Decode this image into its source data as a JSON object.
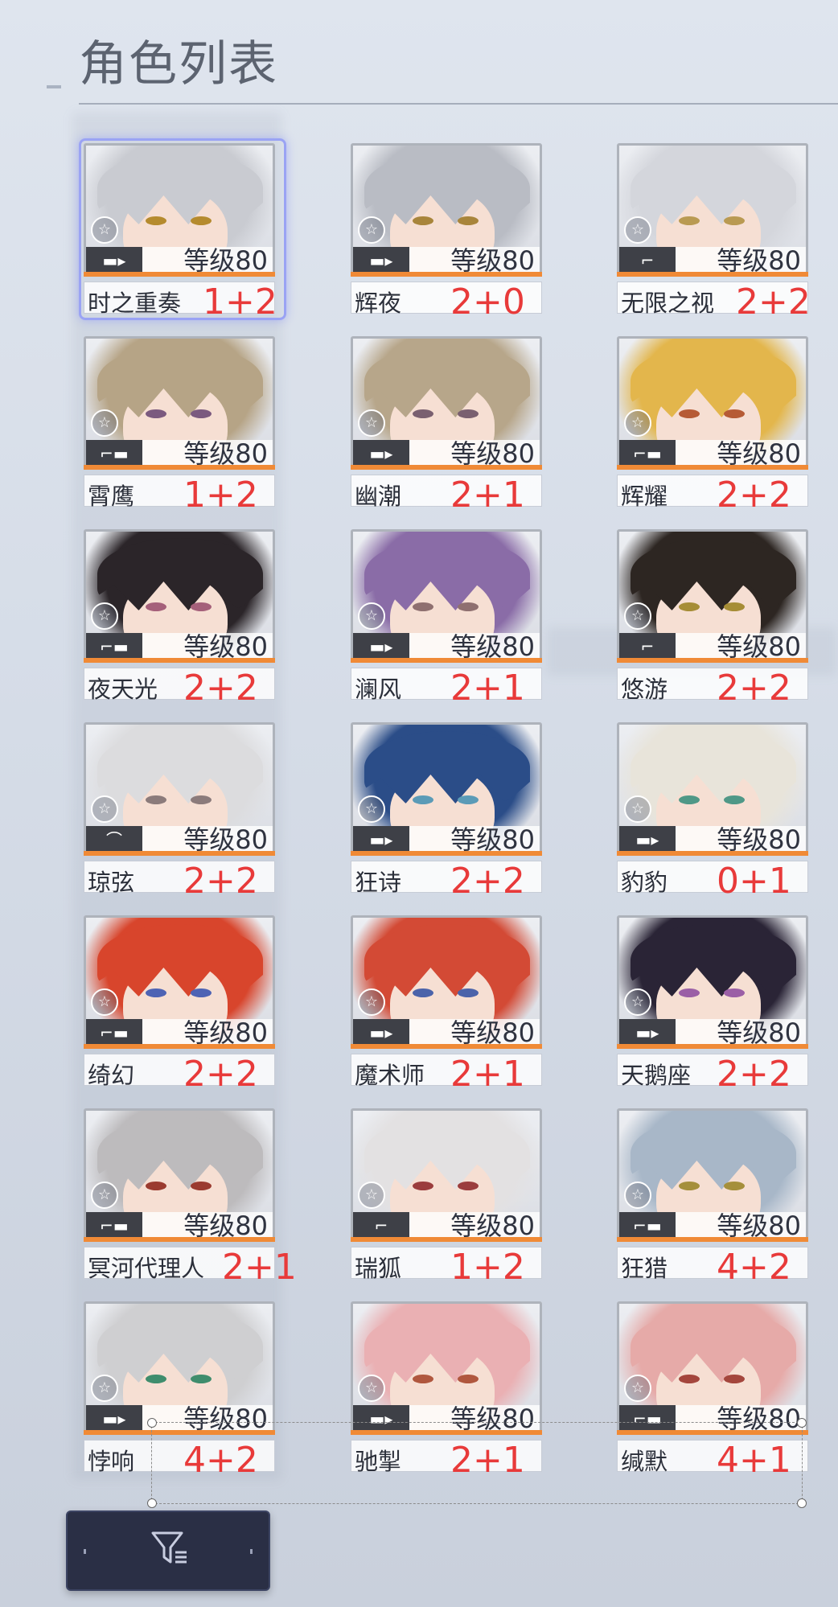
{
  "header": {
    "title": "角色列表"
  },
  "level_prefix": "等级",
  "characters": [
    {
      "name": "时之重奏",
      "level": "80",
      "score": "1+2",
      "hair": "#c9cbd1",
      "eye": "#b58b2e",
      "weapon": "▬▸"
    },
    {
      "name": "辉夜",
      "level": "80",
      "score": "2+0",
      "hair": "#b9bcc4",
      "eye": "#a8853b",
      "weapon": "▬▸"
    },
    {
      "name": "无限之视",
      "level": "80",
      "score": "2+2",
      "hair": "#d4d6dc",
      "eye": "#b99a52",
      "weapon": "⌐"
    },
    {
      "name": "霄鹰",
      "level": "80",
      "score": "1+2",
      "hair": "#b6a486",
      "eye": "#7b5a7f",
      "weapon": "⌐▬"
    },
    {
      "name": "幽潮",
      "level": "80",
      "score": "2+1",
      "hair": "#b7a68a",
      "eye": "#7a6070",
      "weapon": "▬▸"
    },
    {
      "name": "辉耀",
      "level": "80",
      "score": "2+2",
      "hair": "#e3b64c",
      "eye": "#b65b35",
      "weapon": "⌐▬"
    },
    {
      "name": "夜天光",
      "level": "80",
      "score": "2+2",
      "hair": "#2b2529",
      "eye": "#a5607a",
      "weapon": "⌐▬"
    },
    {
      "name": "澜风",
      "level": "80",
      "score": "2+1",
      "hair": "#8a6ca7",
      "eye": "#8f7070",
      "weapon": "▬▸"
    },
    {
      "name": "悠游",
      "level": "80",
      "score": "2+2",
      "hair": "#2d2622",
      "eye": "#a68d36",
      "weapon": "⌐"
    },
    {
      "name": "琼弦",
      "level": "80",
      "score": "2+2",
      "hair": "#dcdcde",
      "eye": "#8b7b7b",
      "weapon": "⌒"
    },
    {
      "name": "狂诗",
      "level": "80",
      "score": "2+2",
      "hair": "#2b4d88",
      "eye": "#5b9bb7",
      "weapon": "▬▸"
    },
    {
      "name": "豹豹",
      "level": "80",
      "score": "0+1",
      "hair": "#e8e4da",
      "eye": "#4f9887",
      "weapon": "▬▸"
    },
    {
      "name": "绮幻",
      "level": "80",
      "score": "2+2",
      "hair": "#d8452c",
      "eye": "#4e63b4",
      "weapon": "⌐▬"
    },
    {
      "name": "魔术师",
      "level": "80",
      "score": "2+1",
      "hair": "#d34a35",
      "eye": "#4b63aa",
      "weapon": "▬▸"
    },
    {
      "name": "天鹅座",
      "level": "80",
      "score": "2+2",
      "hair": "#2a2436",
      "eye": "#9b5fa6",
      "weapon": "▬▸"
    },
    {
      "name": "冥河代理人",
      "level": "80",
      "score": "2+1",
      "hair": "#bdbbbd",
      "eye": "#9b3b30",
      "weapon": "⌐▬"
    },
    {
      "name": "瑞狐",
      "level": "80",
      "score": "1+2",
      "hair": "#e3e1e2",
      "eye": "#9b3d3d",
      "weapon": "⌐"
    },
    {
      "name": "狂猎",
      "level": "80",
      "score": "4+2",
      "hair": "#a8b7c8",
      "eye": "#a58f3b",
      "weapon": "⌐▬"
    },
    {
      "name": "悖响",
      "level": "80",
      "score": "4+2",
      "hair": "#cfcfd1",
      "eye": "#3f8d6d",
      "weapon": "▬▸"
    },
    {
      "name": "驰掣",
      "level": "80",
      "score": "2+1",
      "hair": "#eab0b3",
      "eye": "#b0573e",
      "weapon": "▬▸"
    },
    {
      "name": "缄默",
      "level": "80",
      "score": "4+1",
      "hair": "#e6aaa8",
      "eye": "#a4463d",
      "weapon": "⌐▬"
    }
  ],
  "filter_button": {
    "icon": "filter-icon"
  },
  "icons": {
    "star": "☆"
  }
}
